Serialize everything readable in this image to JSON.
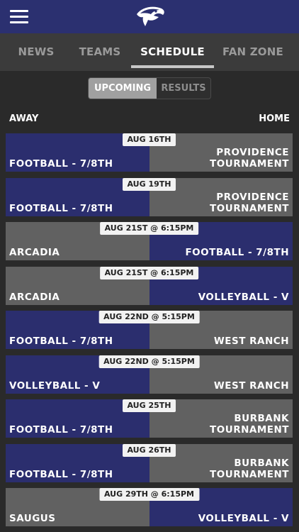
{
  "header": {
    "menu_icon": "hamburger-menu-icon",
    "logo": "hawk-logo"
  },
  "tabs": [
    {
      "label": "NEWS"
    },
    {
      "label": "TEAMS"
    },
    {
      "label": "SCHEDULE"
    },
    {
      "label": "FAN ZONE"
    }
  ],
  "segment": {
    "upcoming": "UPCOMING",
    "results": "RESULTS"
  },
  "columns": {
    "away": "AWAY",
    "home": "HOME"
  },
  "colors": {
    "navy": "#2b2e6e",
    "gray": "#616161",
    "topbar": "#2b3070"
  },
  "games": [
    {
      "date": "AUG 16TH",
      "away": "FOOTBALL - 7/8TH",
      "home": "PROVIDENCE\nTOURNAMENT"
    },
    {
      "date": "AUG 19TH",
      "away": "FOOTBALL - 7/8TH",
      "home": "PROVIDENCE\nTOURNAMENT"
    },
    {
      "date": "AUG 21ST @ 6:15PM",
      "away": "ARCADIA",
      "home": "FOOTBALL - 7/8TH"
    },
    {
      "date": "AUG 21ST @ 6:15PM",
      "away": "ARCADIA",
      "home": "VOLLEYBALL - V"
    },
    {
      "date": "AUG 22ND @ 5:15PM",
      "away": "FOOTBALL - 7/8TH",
      "home": "WEST RANCH"
    },
    {
      "date": "AUG 22ND @ 5:15PM",
      "away": "VOLLEYBALL - V",
      "home": "WEST RANCH"
    },
    {
      "date": "AUG 25TH",
      "away": "FOOTBALL - 7/8TH",
      "home": "BURBANK\nTOURNAMENT"
    },
    {
      "date": "AUG 26TH",
      "away": "FOOTBALL - 7/8TH",
      "home": "BURBANK\nTOURNAMENT"
    },
    {
      "date": "AUG 29TH @ 6:15PM",
      "away": "SAUGUS",
      "home": "VOLLEYBALL - V"
    }
  ]
}
